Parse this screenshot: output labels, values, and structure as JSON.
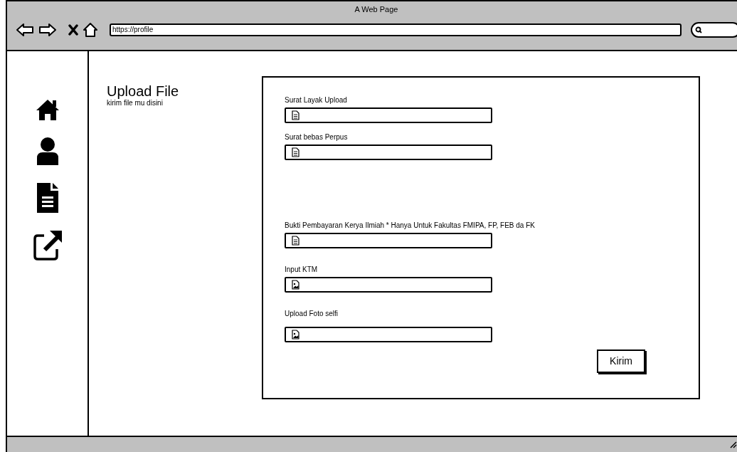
{
  "window": {
    "title": "A Web Page"
  },
  "address_bar": {
    "url": "https://profile"
  },
  "sidebar": {
    "items": [
      {
        "kind": "home"
      },
      {
        "kind": "user"
      },
      {
        "kind": "document"
      },
      {
        "kind": "external"
      }
    ]
  },
  "page": {
    "title": "Upload File",
    "subtitle": "kirim file mu disini"
  },
  "form": {
    "fields": [
      {
        "label": "Surat Layak Upload",
        "kind": "document"
      },
      {
        "label": "Surat bebas Perpus",
        "kind": "document"
      },
      {
        "label": "Bukti Pembayaran Kerya Ilmiah * Hanya Untuk Fakultas FMIPA, FP, FEB da FK",
        "kind": "document"
      },
      {
        "label": "Input KTM",
        "kind": "image"
      },
      {
        "label": "Upload Foto selfi",
        "kind": "image"
      }
    ],
    "submit_button": "Kirim"
  }
}
